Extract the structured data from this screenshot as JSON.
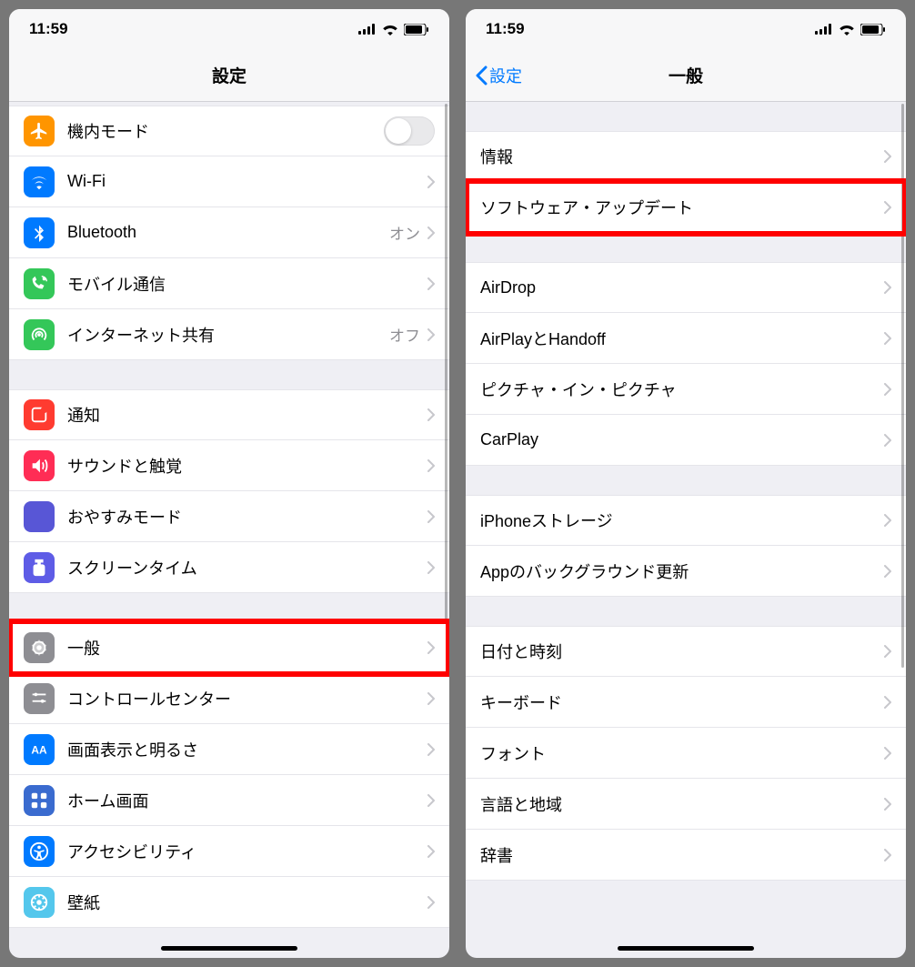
{
  "statusbar": {
    "time": "11:59"
  },
  "left": {
    "title": "設定",
    "groups": [
      {
        "rows": [
          {
            "key": "airplane",
            "label": "機内モード",
            "type": "toggle"
          },
          {
            "key": "wifi",
            "label": "Wi-Fi",
            "value": "",
            "type": "nav"
          },
          {
            "key": "bluetooth",
            "label": "Bluetooth",
            "value": "オン",
            "type": "nav"
          },
          {
            "key": "cellular",
            "label": "モバイル通信",
            "type": "nav"
          },
          {
            "key": "hotspot",
            "label": "インターネット共有",
            "value": "オフ",
            "type": "nav"
          }
        ]
      },
      {
        "rows": [
          {
            "key": "notifications",
            "label": "通知",
            "type": "nav"
          },
          {
            "key": "sounds",
            "label": "サウンドと触覚",
            "type": "nav"
          },
          {
            "key": "dnd",
            "label": "おやすみモード",
            "type": "nav"
          },
          {
            "key": "screentime",
            "label": "スクリーンタイム",
            "type": "nav"
          }
        ]
      },
      {
        "rows": [
          {
            "key": "general",
            "label": "一般",
            "type": "nav",
            "highlight": true
          },
          {
            "key": "controlcenter",
            "label": "コントロールセンター",
            "type": "nav"
          },
          {
            "key": "display",
            "label": "画面表示と明るさ",
            "type": "nav"
          },
          {
            "key": "homescreen",
            "label": "ホーム画面",
            "type": "nav"
          },
          {
            "key": "accessibility",
            "label": "アクセシビリティ",
            "type": "nav"
          },
          {
            "key": "wallpaper",
            "label": "壁紙",
            "type": "nav"
          }
        ]
      }
    ]
  },
  "right": {
    "back": "設定",
    "title": "一般",
    "groups": [
      {
        "rows": [
          {
            "key": "about",
            "label": "情報",
            "type": "nav"
          },
          {
            "key": "swupdate",
            "label": "ソフトウェア・アップデート",
            "type": "nav",
            "highlight": true
          }
        ]
      },
      {
        "rows": [
          {
            "key": "airdrop",
            "label": "AirDrop",
            "type": "nav"
          },
          {
            "key": "airplay",
            "label": "AirPlayとHandoff",
            "type": "nav"
          },
          {
            "key": "pip",
            "label": "ピクチャ・イン・ピクチャ",
            "type": "nav"
          },
          {
            "key": "carplay",
            "label": "CarPlay",
            "type": "nav"
          }
        ]
      },
      {
        "rows": [
          {
            "key": "storage",
            "label": "iPhoneストレージ",
            "type": "nav"
          },
          {
            "key": "bgrefresh",
            "label": "Appのバックグラウンド更新",
            "type": "nav"
          }
        ]
      },
      {
        "rows": [
          {
            "key": "datetime",
            "label": "日付と時刻",
            "type": "nav"
          },
          {
            "key": "keyboard",
            "label": "キーボード",
            "type": "nav"
          },
          {
            "key": "fonts",
            "label": "フォント",
            "type": "nav"
          },
          {
            "key": "language",
            "label": "言語と地域",
            "type": "nav"
          },
          {
            "key": "dictionary",
            "label": "辞書",
            "type": "nav"
          }
        ]
      }
    ]
  }
}
